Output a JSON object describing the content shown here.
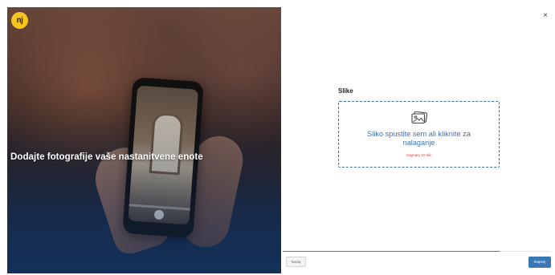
{
  "brand": {
    "logo_text": "nj"
  },
  "hero": {
    "title": "Dodajte fotografije vaše nastanitvene enote"
  },
  "dialog": {
    "close_symbol": "×"
  },
  "upload": {
    "section_label": "Slike",
    "icon": "image-icon",
    "dropzone_text": "Sliko spustite sem ali kliknite za nalaganje",
    "limit_text": "Najmanj 10 slik"
  },
  "progress": {
    "value": 0.81
  },
  "footer": {
    "back_label": "Nazaj",
    "next_label": "Naprej"
  },
  "colors": {
    "accent": "#3a78b5",
    "dropzone_text": "#3c72b2",
    "limit_text": "#d2453e",
    "logo": "#f7c41b"
  }
}
